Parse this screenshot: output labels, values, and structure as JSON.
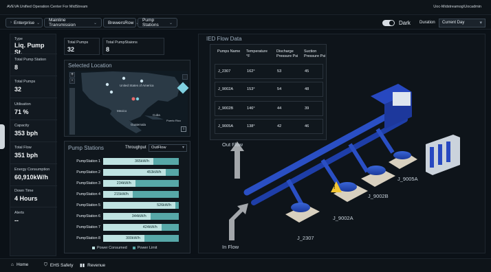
{
  "app": {
    "title": "AVEVA Unified Operation Center For MidStream",
    "user": "Uoc-Midstreamog\\Uocadmin"
  },
  "breadcrumb": [
    {
      "label": "Enterprise"
    },
    {
      "label": "Mainline Transmission"
    },
    {
      "label": "BrewersRow"
    },
    {
      "label": "Pump Stations"
    }
  ],
  "header": {
    "theme_label": "Dark",
    "duration_label": "Duration",
    "duration_value": "Current Day"
  },
  "kpis": {
    "type": {
      "label": "Type",
      "value": "Liq. Pump St."
    },
    "total_pump_station": {
      "label": "Total Pump Station",
      "value": "8"
    },
    "total_pumps": {
      "label": "Total Pumps",
      "value": "32"
    },
    "utilisation": {
      "label": "Utilisation",
      "value": "71 %"
    },
    "capacity": {
      "label": "Capacity",
      "value": "353 bph"
    },
    "total_flow": {
      "label": "Total Flow",
      "value": "351 bph"
    },
    "energy": {
      "label": "Energy Consumption",
      "value": "60,910kW/h"
    },
    "down_time": {
      "label": "Down Time",
      "value": "4  Hours"
    },
    "alerts": {
      "label": "Alerts",
      "value": "--"
    }
  },
  "summary": {
    "total_pumps": {
      "label": "Total Pumps",
      "value": "32"
    },
    "total_pump_stations": {
      "label": "Total  PumpStaions",
      "value": "8"
    }
  },
  "location": {
    "title": "Selected Location",
    "zoom_in": "+",
    "zoom_out": "-",
    "map_labels": {
      "us": "United States of America",
      "mexico": "Mexico",
      "cuba": "Cuba",
      "puerto_rico": "Puerto Rico",
      "guatemala": "Guatemala"
    },
    "info": "i"
  },
  "pump_stations": {
    "title": "Pump Stations",
    "throughput_label": "Throughput",
    "throughput_value": "OutFlow",
    "legend": {
      "consumed": "Power Consumed",
      "limit": "Power Limit"
    },
    "colors": {
      "consumed": "#bfe3e2",
      "limit": "#57a8a8"
    }
  },
  "chart_data": {
    "type": "bar",
    "title": "Pump Stations",
    "categories": [
      "PumpStation 1",
      "PumpStation 2",
      "PumpStation 3",
      "PumpStation 4",
      "PumpStation 5",
      "PumpStation 6",
      "PumpStation 7",
      "PumpStation 8"
    ],
    "series": [
      {
        "name": "Power Consumed",
        "values": [
          365,
          453,
          234,
          215,
          526,
          344,
          424,
          300
        ],
        "labels": [
          "365kW/h",
          "453kW/h",
          "234kW/h",
          "215kW/h",
          "526kW/h",
          "344kW/h",
          "424kW/h",
          "300kW/h"
        ]
      },
      {
        "name": "Power Limit",
        "values": [
          550,
          550,
          550,
          550,
          550,
          550,
          550,
          550
        ]
      }
    ]
  },
  "ied": {
    "title": "IED Flow Data",
    "headers": {
      "pump": "Pumps Name",
      "temp": "Temperature °F",
      "discharge": "Discharge Pressure Psi",
      "suction": "Suction Pressure Psi"
    },
    "rows": [
      {
        "pump": "J_2307",
        "temp": "162°",
        "discharge": "53",
        "suction": "45"
      },
      {
        "pump": "J_9002A",
        "temp": "153°",
        "discharge": "54",
        "suction": "48"
      },
      {
        "pump": "J_9002B",
        "temp": "146°",
        "discharge": "44",
        "suction": "39"
      },
      {
        "pump": "J_9005A",
        "temp": "138°",
        "discharge": "42",
        "suction": "46"
      }
    ]
  },
  "diagram": {
    "out_flow": "Out Flow",
    "in_flow": "In Flow",
    "pumps": {
      "j9005a": "J_9005A",
      "j9002b": "J_9002B",
      "j9002a": "J_9002A",
      "j2307": "J_2307"
    },
    "warning": "!"
  },
  "footer": {
    "home": "Home",
    "ehs": "EHS Safety",
    "revenue": "Revenue"
  }
}
